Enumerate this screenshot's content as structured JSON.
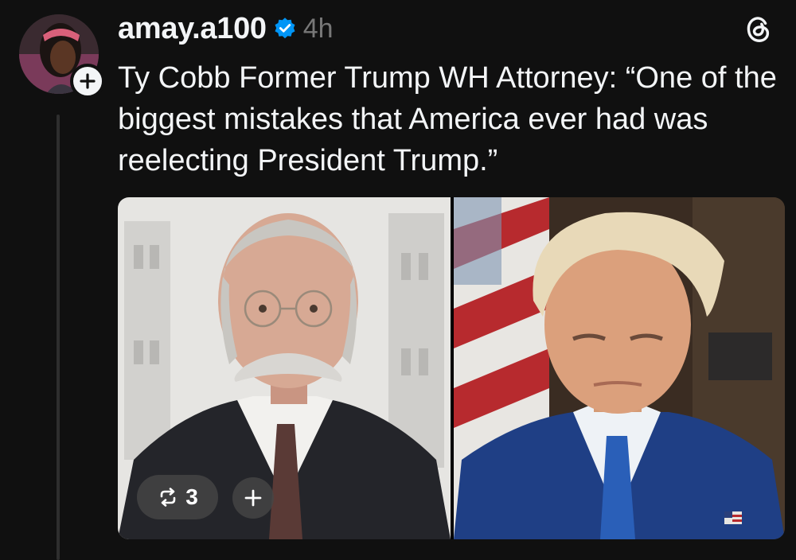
{
  "post": {
    "username": "amay.a100",
    "timestamp": "4h",
    "text": "Ty Cobb Former Trump WH Attorney: “One of the biggest mistakes that America ever had was reelecting President Trump.”",
    "repost_count": "3"
  },
  "icons": {
    "verified": "verified-badge-icon",
    "threads_logo": "threads-logo-icon",
    "follow": "plus-icon",
    "repost": "repost-icon",
    "add": "plus-icon"
  },
  "colors": {
    "background": "#101010",
    "text": "#f3f5f7",
    "muted": "#777777",
    "verified": "#0095f6"
  }
}
